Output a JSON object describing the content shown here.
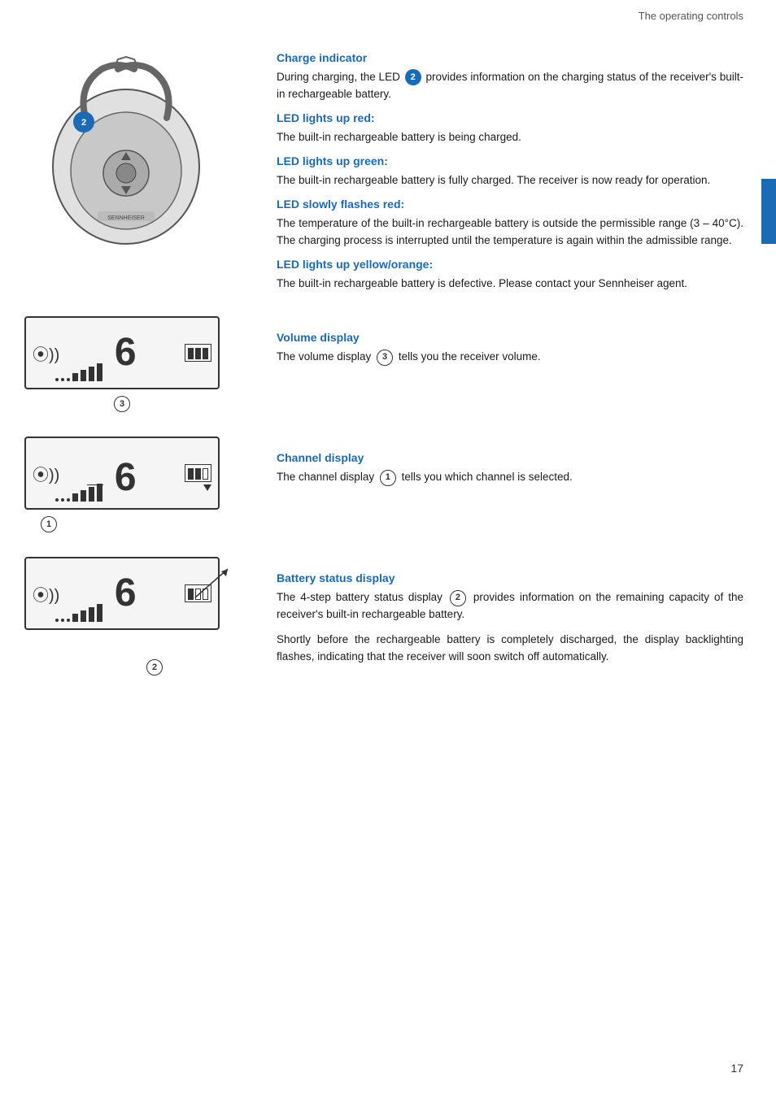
{
  "header": {
    "title": "The operating controls"
  },
  "sections": {
    "charge_indicator": {
      "heading": "Charge indicator",
      "intro": "During charging, the LED",
      "led_number": "2",
      "intro_rest": "provides information on the charging status of the receiver's built-in rechargeable battery.",
      "led_red": {
        "heading": "LED lights up red:",
        "text": "The built-in rechargeable battery is being charged."
      },
      "led_green": {
        "heading": "LED lights up green:",
        "text": "The built-in rechargeable battery is fully charged. The receiver is now ready for operation."
      },
      "led_red_flash": {
        "heading": "LED slowly flashes red:",
        "text": "The temperature of the built-in rechargeable battery is outside the permissible range (3 – 40°C). The charging process is interrupted until the temperature is again within the admissible range."
      },
      "led_yellow": {
        "heading": "LED lights up yellow/orange:",
        "text": "The built-in rechargeable battery is defective. Please contact your Sennheiser agent."
      }
    },
    "volume_display": {
      "heading": "Volume display",
      "text": "The volume display",
      "circle_number": "3",
      "text_rest": "tells you the receiver volume.",
      "device_number": "3"
    },
    "channel_display": {
      "heading": "Channel display",
      "text": "The channel display",
      "circle_number": "1",
      "text_rest": "tells you which channel is selected.",
      "device_number": "1"
    },
    "battery_status": {
      "heading": "Battery status display",
      "text1_prefix": "The 4-step battery status display",
      "circle_number": "2",
      "text1_rest": "provides information on the remaining capacity of the receiver's built-in rechargeable battery.",
      "text2": "Shortly before the rechargeable battery is completely discharged, the display backlighting flashes, indicating that the receiver will soon switch off automatically.",
      "device_number": "2"
    }
  },
  "page_number": "17",
  "colors": {
    "accent": "#1a6ab5",
    "text_dark": "#1a1a1a",
    "text_gray": "#555"
  }
}
